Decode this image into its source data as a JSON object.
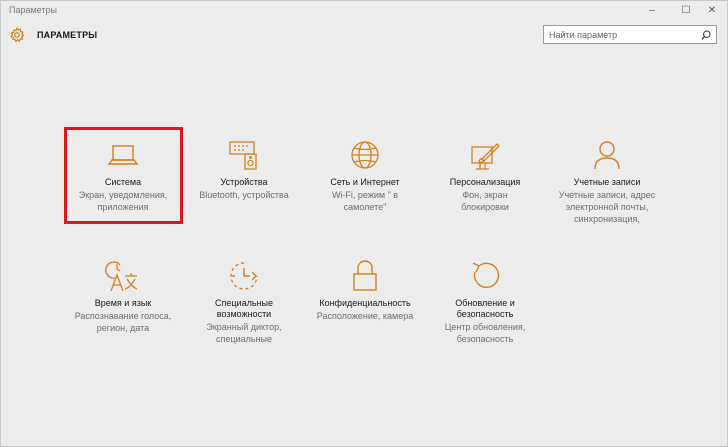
{
  "window": {
    "title": "Параметры",
    "minimize": "–",
    "maximize": "☐",
    "close": "✕"
  },
  "header": {
    "app_title": "ПАРАМЕТРЫ"
  },
  "search": {
    "placeholder": "Найти параметр"
  },
  "accent_color": "#d67f1f",
  "highlight_color": "#e0161f",
  "tiles": [
    {
      "icon": "laptop-icon",
      "title": "Система",
      "desc": "Экран, уведомления, приложения"
    },
    {
      "icon": "devices-icon",
      "title": "Устройства",
      "desc": "Bluetooth, устройства"
    },
    {
      "icon": "globe-icon",
      "title": "Сеть и Интернет",
      "desc": "Wi-Fi, режим \" в самолете\""
    },
    {
      "icon": "personalization-icon",
      "title": "Персонализация",
      "desc": "Фон, экран блокировки"
    },
    {
      "icon": "person-icon",
      "title": "Учетные записи",
      "desc": "Учетные записи, адрес электронной почты, синхронизация,"
    },
    {
      "icon": "time-language-icon",
      "title": "Время и язык",
      "desc": "Распознавание голоса, регион, дата"
    },
    {
      "icon": "ease-of-access-icon",
      "title": "Специальные возможности",
      "desc": "Экранный диктор, специальные"
    },
    {
      "icon": "lock-icon",
      "title": "Конфиденциальность",
      "desc": "Расположение, камера"
    },
    {
      "icon": "update-icon",
      "title": "Обновление и безопасность",
      "desc": "Центр обновления, безопасность"
    }
  ]
}
